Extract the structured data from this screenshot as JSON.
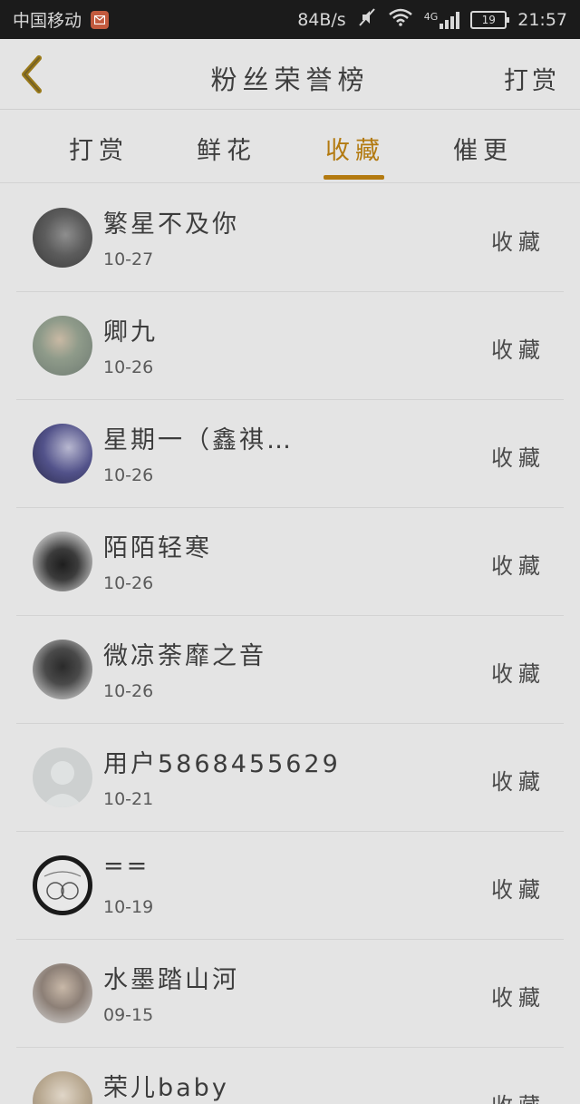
{
  "status_bar": {
    "carrier": "中国移动",
    "speed": "84B/s",
    "network": "4G",
    "battery": "19",
    "time": "21:57"
  },
  "header": {
    "title": "粉丝荣誉榜",
    "right_action": "打赏"
  },
  "tabs": [
    {
      "label": "打赏",
      "active": false
    },
    {
      "label": "鲜花",
      "active": false
    },
    {
      "label": "收藏",
      "active": true
    },
    {
      "label": "催更",
      "active": false
    }
  ],
  "accent_color": "#b37a10",
  "list": [
    {
      "name": "繁星不及你",
      "date": "10-27",
      "action": "收藏"
    },
    {
      "name": "卿九",
      "date": "10-26",
      "action": "收藏"
    },
    {
      "name": "星期一（鑫祺…",
      "date": "10-26",
      "action": "收藏"
    },
    {
      "name": "陌陌轻寒",
      "date": "10-26",
      "action": "收藏"
    },
    {
      "name": "微凉荼靡之音",
      "date": "10-26",
      "action": "收藏"
    },
    {
      "name": "用户5868455629",
      "date": "10-21",
      "action": "收藏"
    },
    {
      "name": "==",
      "date": "10-19",
      "action": "收藏"
    },
    {
      "name": "水墨踏山河",
      "date": "09-15",
      "action": "收藏"
    },
    {
      "name": "荣儿baby",
      "date": "",
      "action": "收藏"
    }
  ]
}
